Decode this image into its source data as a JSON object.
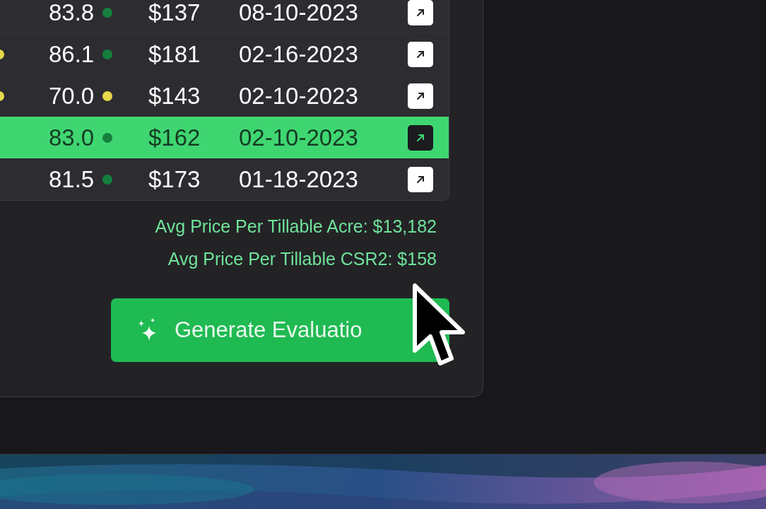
{
  "table": {
    "rows": [
      {
        "selected": false,
        "score": "83.8",
        "score_dot": {
          "color": "#15803d"
        },
        "price": "$137",
        "date": "08-10-2023"
      },
      {
        "selected": false,
        "left_dot": {
          "color": "#e5d84a"
        },
        "score": "86.1",
        "score_dot": {
          "color": "#15803d"
        },
        "price": "$181",
        "date": "02-16-2023"
      },
      {
        "selected": false,
        "left_dot": {
          "color": "#e5d84a"
        },
        "score": "70.0",
        "score_dot": {
          "color": "#e5d84a"
        },
        "price": "$143",
        "date": "02-10-2023"
      },
      {
        "selected": true,
        "score": "83.0",
        "score_dot": {
          "color": "#15803d"
        },
        "price": "$162",
        "date": "02-10-2023"
      },
      {
        "selected": false,
        "score": "81.5",
        "score_dot": {
          "color": "#15803d"
        },
        "price": "$173",
        "date": "01-18-2023"
      }
    ]
  },
  "summary": [
    "Avg Price Per Tillable Acre: $13,182",
    "Avg Price Per Tillable CSR2: $158"
  ],
  "generate_button": {
    "label": "Generate Evaluatio"
  }
}
